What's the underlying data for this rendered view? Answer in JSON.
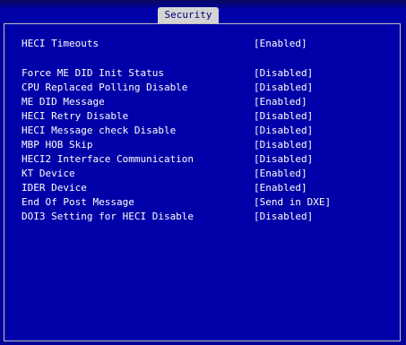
{
  "tabs": {
    "active": "Security"
  },
  "settings": {
    "heci_timeouts": {
      "label": "HECI Timeouts",
      "value": "[Enabled]"
    },
    "items": [
      {
        "label": "Force ME DID Init Status",
        "value": "[Disabled]"
      },
      {
        "label": "CPU Replaced Polling Disable",
        "value": "[Disabled]"
      },
      {
        "label": "ME DID Message",
        "value": "[Enabled]"
      },
      {
        "label": "HECI Retry Disable",
        "value": "[Disabled]"
      },
      {
        "label": "HECI Message check Disable",
        "value": "[Disabled]"
      },
      {
        "label": "MBP HOB Skip",
        "value": "[Disabled]"
      },
      {
        "label": "HECI2 Interface Communication",
        "value": "[Disabled]"
      },
      {
        "label": "KT Device",
        "value": "[Enabled]"
      },
      {
        "label": "IDER Device",
        "value": "[Enabled]"
      },
      {
        "label": "End Of Post Message",
        "value": "[Send in DXE]"
      },
      {
        "label": "DOI3 Setting for HECI Disable",
        "value": "[Disabled]"
      }
    ]
  },
  "colors": {
    "background": "#0000a8",
    "tab_bg": "#d4d4d4",
    "tab_text": "#00007a",
    "text": "#ffffff"
  }
}
